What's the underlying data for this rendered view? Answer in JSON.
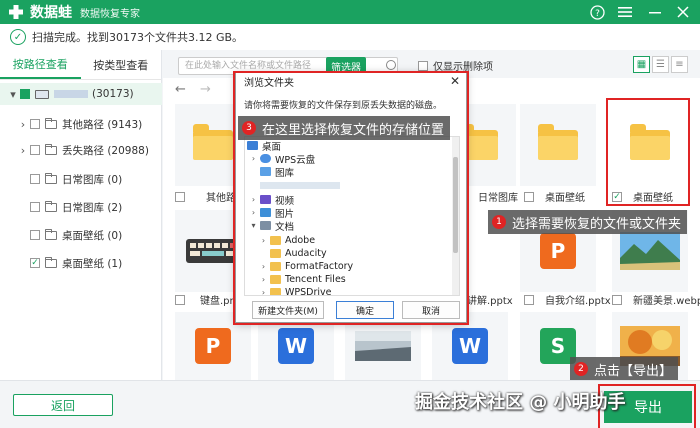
{
  "app": {
    "name": "数据蛙",
    "subtitle": "数据恢复专家"
  },
  "status": {
    "text": "扫描完成。找到30173个文件共3.12 GB。"
  },
  "left_panel": {
    "tabs": [
      {
        "label": "按路径查看"
      },
      {
        "label": "按类型查看"
      }
    ],
    "root_label": "(30173)",
    "items": [
      {
        "label": "其他路径 (9143)"
      },
      {
        "label": "丢失路径 (20988)"
      },
      {
        "label": "日常图库 (0)"
      },
      {
        "label": "日常图库 (2)"
      },
      {
        "label": "桌面壁纸 (0)"
      },
      {
        "label": "桌面壁纸 (1)"
      }
    ]
  },
  "toolbar": {
    "search_placeholder": "在此处输入文件名称或文件路径",
    "filter_label": "筛选器",
    "deleted_only_label": "仅显示删除项"
  },
  "files": {
    "row1": [
      {
        "label": "其他路径"
      },
      {
        "label": "日常图库"
      },
      {
        "label": "桌面壁纸"
      },
      {
        "label": "桌面壁纸"
      }
    ],
    "row2": [
      {
        "label": "键盘.png"
      },
      {
        "label": "讲解.pptx"
      },
      {
        "label": "自我介绍.pptx"
      },
      {
        "label": "新疆美景.webp"
      }
    ],
    "row3_icons": [
      "P",
      "W",
      "W",
      "S"
    ]
  },
  "dialog": {
    "title": "浏览文件夹",
    "description": "请你将需要恢复的文件保存到原丢失数据的磁盘。",
    "tree": [
      {
        "label": "桌面"
      },
      {
        "label": "WPS云盘"
      },
      {
        "label": "图库"
      },
      {
        "label": "视频"
      },
      {
        "label": "图片"
      },
      {
        "label": "文档"
      },
      {
        "label": "Adobe"
      },
      {
        "label": "Audacity"
      },
      {
        "label": "FormatFactory"
      },
      {
        "label": "Tencent Files"
      },
      {
        "label": "WPSDrive"
      }
    ],
    "new_folder_label": "新建文件夹(M)",
    "ok_label": "确定",
    "cancel_label": "取消"
  },
  "callouts": {
    "step1": {
      "num": "1",
      "text": "选择需要恢复的文件或文件夹"
    },
    "step2": {
      "num": "2",
      "text": "点击【导出】"
    },
    "step3": {
      "num": "3",
      "text": "在这里选择恢复文件的存储位置"
    }
  },
  "bottom": {
    "back_label": "返回",
    "export_label": "导出",
    "watermark": "掘金技术社区 @ 小明助手"
  },
  "colors": {
    "brand": "#1aa260",
    "highlight": "#e02424"
  }
}
